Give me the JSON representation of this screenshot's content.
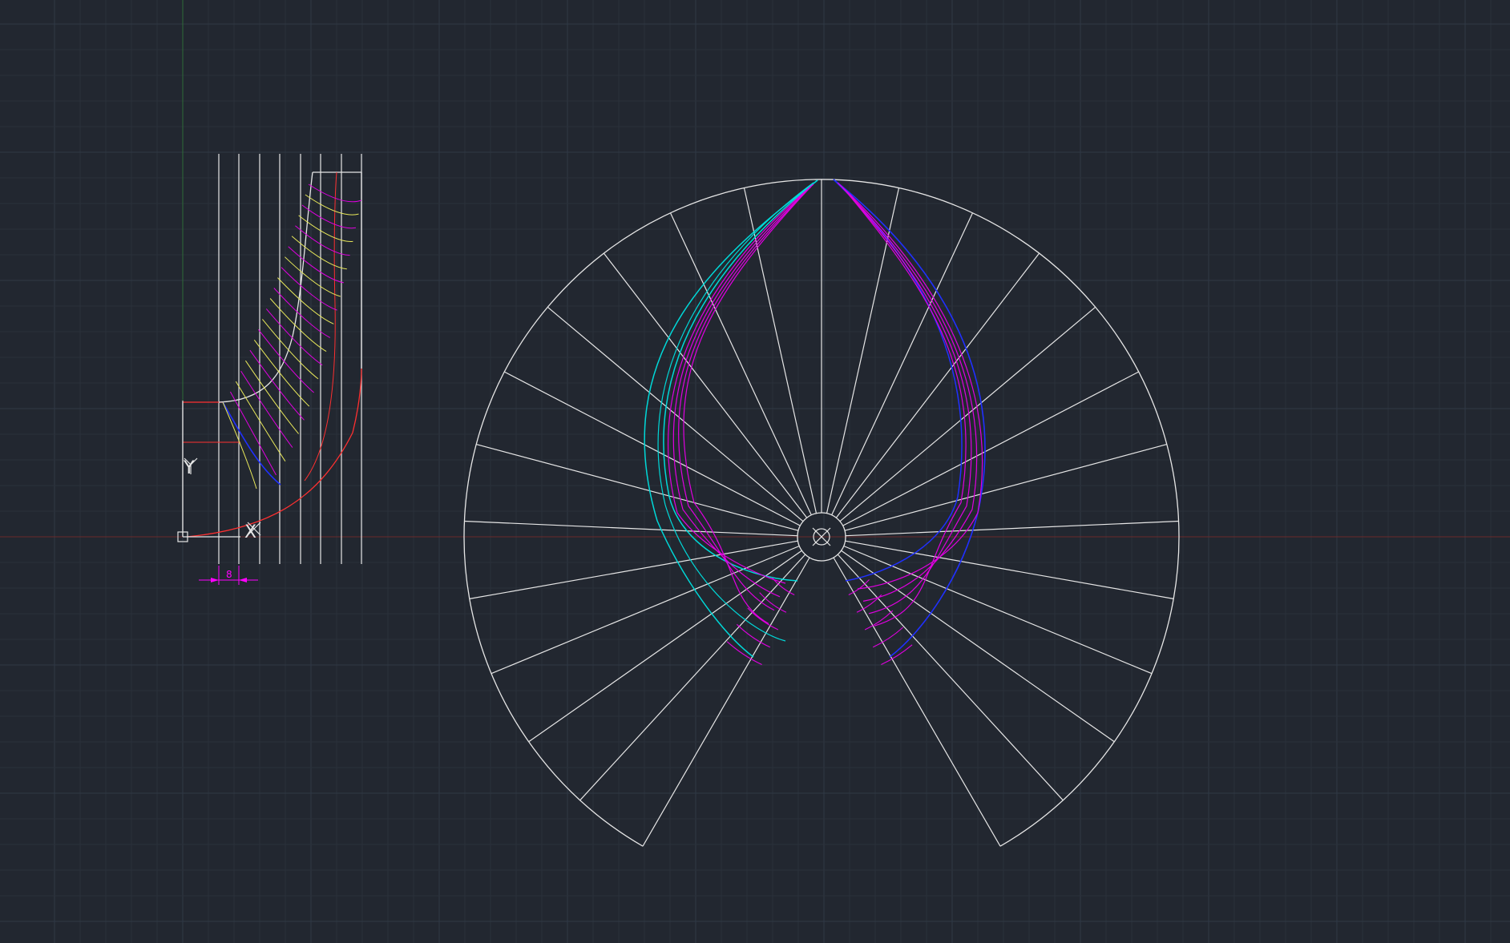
{
  "app": {
    "background": "#222730",
    "grid_minor_color": "#2a303a",
    "grid_major_color": "#303845"
  },
  "axes": {
    "x_axis_color": "#6b2a2a",
    "y_axis_color": "#2f6b38",
    "ucs_labels": {
      "x": "X",
      "y": "Y"
    }
  },
  "dimension": {
    "text": "8",
    "color": "#ff00ff"
  },
  "colors": {
    "white": "#e6e6e6",
    "red": "#ff3030",
    "yellow": "#e8e85a",
    "magenta": "#e000e0",
    "cyan": "#00d8d8",
    "blue": "#2030ff"
  },
  "drawing": {
    "meridional_view": "impeller-meridional-section",
    "blade_plan_view": "blade-plan-radial-lines",
    "radial_divisions": 32
  }
}
